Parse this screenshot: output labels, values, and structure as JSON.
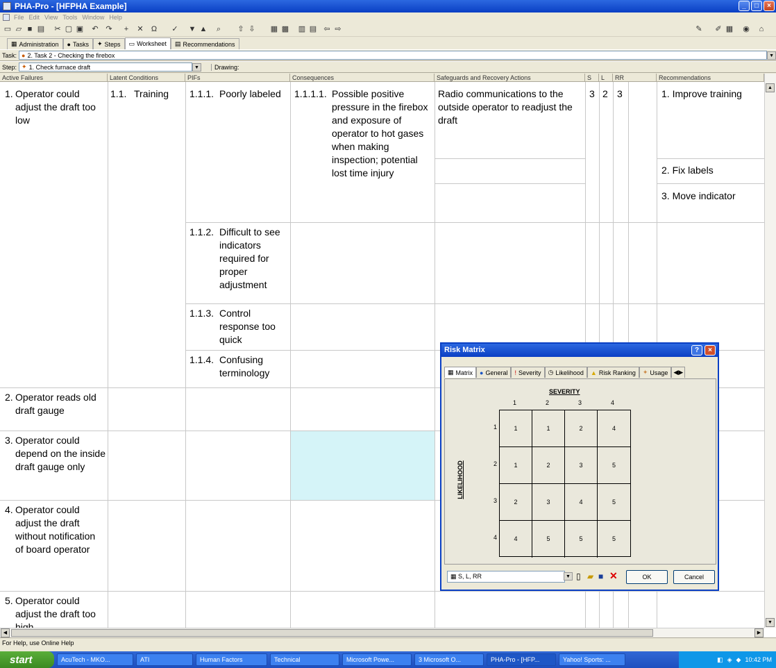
{
  "window": {
    "title": "PHA-Pro - [HFPHA Example]"
  },
  "menu": [
    "File",
    "Edit",
    "View",
    "Tools",
    "Window",
    "Help"
  ],
  "tabs": [
    "Administration",
    "Tasks",
    "Steps",
    "Worksheet",
    "Recommendations"
  ],
  "task": {
    "label": "Task:",
    "value": "2.  Task 2 - Checking the firebox"
  },
  "step": {
    "label": "Step:",
    "value": "1.  Check furnace draft",
    "drawing": "Drawing:"
  },
  "columns": [
    "Active Failures",
    "Latent Conditions",
    "PIFs",
    "Consequences",
    "Safeguards and Recovery Actions",
    "S",
    "L",
    "RR",
    "Recommendations"
  ],
  "rows": {
    "af1": {
      "n": "1.",
      "t": "Operator could adjust the draft too low"
    },
    "lc1": {
      "n": "1.1.",
      "t": "Training"
    },
    "pif1": {
      "n": "1.1.1.",
      "t": "Poorly labeled"
    },
    "pif2": {
      "n": "1.1.2.",
      "t": "Difficult to see indicators required for proper adjustment"
    },
    "pif3": {
      "n": "1.1.3.",
      "t": "Control response too quick"
    },
    "pif4": {
      "n": "1.1.4.",
      "t": "Confusing terminology"
    },
    "con1": {
      "n": "1.1.1.1.",
      "t": "Possible positive pressure in the firebox and exposure of operator to hot gases when making inspection; potential lost time injury"
    },
    "sg1": {
      "t": "Radio communications to the outside operator to readjust the draft"
    },
    "s": "3",
    "l": "2",
    "rr": "3",
    "rec1": "1. Improve training",
    "rec2": "2. Fix labels",
    "rec3": "3. Move indicator",
    "af2": {
      "n": "2.",
      "t": "Operator reads old draft gauge"
    },
    "af3": {
      "n": "3.",
      "t": "Operator could depend on the inside draft gauge only"
    },
    "af4": {
      "n": "4.",
      "t": "Operator could adjust the draft without notification of board operator"
    },
    "af5": {
      "n": "5.",
      "t": "Operator could adjust the draft too high"
    }
  },
  "status": "For Help, use Online Help",
  "taskbar": {
    "start": "start",
    "items": [
      "AcuTech - MKO...",
      "ATI",
      "Human Factors",
      "Technical",
      "Microsoft Powe...",
      "3 Microsoft O...",
      "PHA-Pro - [HFP...",
      "Yahoo! Sports: ..."
    ],
    "clock": "10:42 PM"
  },
  "dialog": {
    "title": "Risk Matrix",
    "tabs": [
      "Matrix",
      "General",
      "Severity",
      "Likelihood",
      "Risk Ranking",
      "Usage"
    ],
    "severity_label": "SEVERITY",
    "likelihood_label": "LIKELIHOOD",
    "sev_cols": [
      "1",
      "2",
      "3",
      "4"
    ],
    "lik_rows": [
      "1",
      "2",
      "3",
      "4"
    ],
    "matrix": [
      [
        "1",
        "1",
        "2",
        "4"
      ],
      [
        "1",
        "2",
        "3",
        "5"
      ],
      [
        "2",
        "3",
        "4",
        "5"
      ],
      [
        "4",
        "5",
        "5",
        "5"
      ]
    ],
    "select": "S, L, RR",
    "ok": "OK",
    "cancel": "Cancel"
  }
}
